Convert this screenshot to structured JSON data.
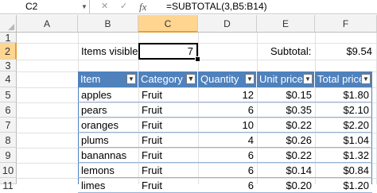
{
  "formula_bar": {
    "name_box": "C2",
    "fx_label": "fx",
    "formula": "=SUBTOTAL(3,B5:B14)"
  },
  "columns": [
    "A",
    "B",
    "C",
    "D",
    "E",
    "F"
  ],
  "rows": [
    "1",
    "2",
    "3",
    "4",
    "5",
    "6",
    "7",
    "8",
    "9",
    "10",
    "11"
  ],
  "selected_column": "C",
  "selected_row": "2",
  "summary": {
    "items_visible_label": "Items visible:",
    "items_visible_value": "7",
    "subtotal_label": "Subtotal:",
    "subtotal_value": "$9.54"
  },
  "table": {
    "headers": [
      "Item",
      "Category",
      "Quantity",
      "Unit price",
      "Total price"
    ],
    "filtered_column": "Category",
    "rows": [
      {
        "item": "apples",
        "category": "Fruit",
        "quantity": "12",
        "unit_price": "$0.15",
        "total_price": "$1.80"
      },
      {
        "item": "pears",
        "category": "Fruit",
        "quantity": "6",
        "unit_price": "$0.35",
        "total_price": "$2.10"
      },
      {
        "item": "oranges",
        "category": "Fruit",
        "quantity": "10",
        "unit_price": "$0.22",
        "total_price": "$2.20"
      },
      {
        "item": "plums",
        "category": "Fruit",
        "quantity": "4",
        "unit_price": "$0.26",
        "total_price": "$1.04"
      },
      {
        "item": "banannas",
        "category": "Fruit",
        "quantity": "6",
        "unit_price": "$0.22",
        "total_price": "$1.32"
      },
      {
        "item": "lemons",
        "category": "Fruit",
        "quantity": "6",
        "unit_price": "$0.14",
        "total_price": "$0.84"
      },
      {
        "item": "limes",
        "category": "Fruit",
        "quantity": "6",
        "unit_price": "$0.20",
        "total_price": "$1.20"
      }
    ]
  },
  "colors": {
    "header_fill": "#4f81bd",
    "selection_header": "#ffd58f",
    "row_border": "#95b3d7"
  }
}
